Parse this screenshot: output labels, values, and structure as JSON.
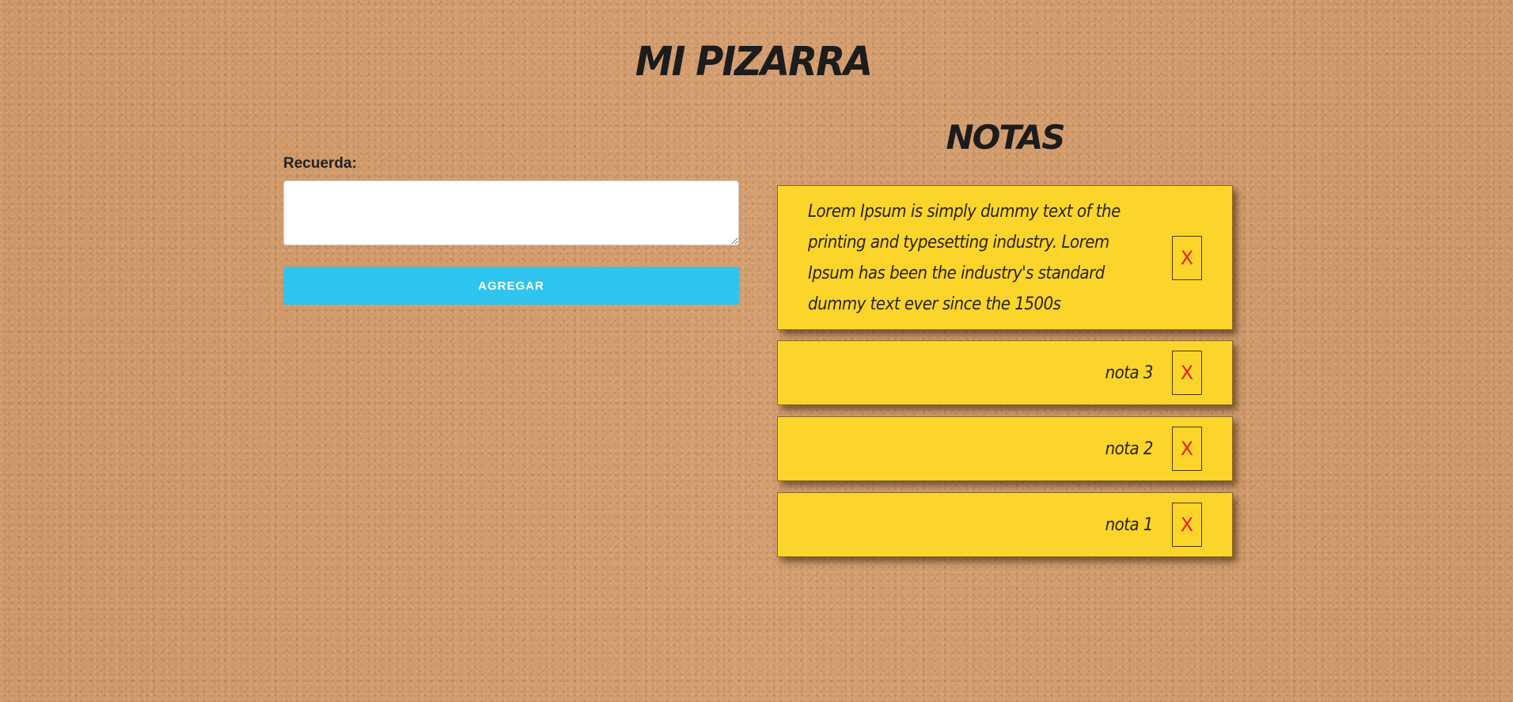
{
  "app": {
    "title": "MI PIZARRA"
  },
  "form": {
    "label": "Recuerda:",
    "textarea_value": "",
    "textarea_placeholder": "",
    "add_button_label": "AGREGAR"
  },
  "notes": {
    "title": "NOTAS",
    "items": [
      {
        "text": "Lorem Ipsum is simply dummy text of the printing and typesetting industry. Lorem Ipsum has been the industry's standard dummy text ever since the 1500s",
        "delete_label": "X"
      },
      {
        "text": "nota 3",
        "delete_label": "X"
      },
      {
        "text": "nota 2",
        "delete_label": "X"
      },
      {
        "text": "nota 1",
        "delete_label": "X"
      }
    ]
  },
  "colors": {
    "note_background": "#fcd52b",
    "add_button": "#2fc4ee",
    "delete_text": "#e8231a",
    "cork_background": "#d29a6a"
  }
}
